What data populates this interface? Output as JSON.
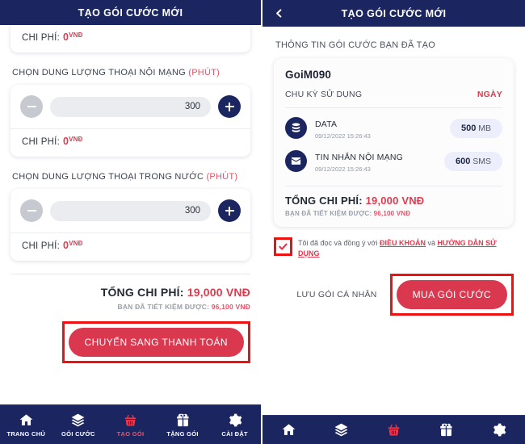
{
  "left": {
    "appbar": {
      "title": "TẠO GÓI CƯỚC MỚI"
    },
    "top_cost": {
      "label": "CHI PHÍ:",
      "amount": "0",
      "currency": "VNĐ"
    },
    "sections": [
      {
        "label": "CHỌN DUNG LƯỢNG THOẠI NỘI MẠNG",
        "unit": "(PHÚT)",
        "quantity": "300",
        "cost_label": "CHI PHÍ:",
        "cost_amount": "0",
        "cost_currency": "VNĐ"
      },
      {
        "label": "CHỌN DUNG LƯỢNG THOẠI TRONG NƯỚC",
        "unit": "(PHÚT)",
        "quantity": "300",
        "cost_label": "CHI PHÍ:",
        "cost_amount": "0",
        "cost_currency": "VNĐ"
      }
    ],
    "totals": {
      "total_label": "TỔNG CHI PHÍ:",
      "total_value": "19,000 VNĐ",
      "save_label": "BẠN ĐÃ TIẾT KIỆM ĐƯỢC:",
      "save_value": "96,100 VNĐ"
    },
    "cta": {
      "label": "CHUYỂN SANG THANH TOÁN"
    },
    "nav": [
      {
        "label": "TRANG CHỦ",
        "icon": "home-icon",
        "active": false
      },
      {
        "label": "GÓI CƯỚC",
        "icon": "layers-icon",
        "active": false
      },
      {
        "label": "TẠO GÓI",
        "icon": "basket-icon",
        "active": true
      },
      {
        "label": "TẶNG GÓI",
        "icon": "gift-icon",
        "active": false
      },
      {
        "label": "CÀI ĐẶT",
        "icon": "gear-icon",
        "active": false
      }
    ]
  },
  "right": {
    "appbar": {
      "title": "TẠO GÓI CƯỚC MỚI",
      "back_icon": "chevron-left-icon"
    },
    "section_title": "THÔNG TIN GÓI CƯỚC BẠN ĐÃ TẠO",
    "package": {
      "name": "GoiM090",
      "cycle_label": "CHU KỲ SỬ DỤNG",
      "cycle_value": "NGÀY",
      "features": [
        {
          "icon": "database-icon",
          "title": "DATA",
          "date": "09/12/2022 15:26:43",
          "badge_value": "500",
          "badge_unit": "MB"
        },
        {
          "icon": "envelope-icon",
          "title": "TIN NHẮN NỘI MẠNG",
          "date": "09/12/2022 15:26:43",
          "badge_value": "600",
          "badge_unit": "SMS"
        }
      ],
      "total_label": "TỔNG CHI PHÍ:",
      "total_value": "19,000 VNĐ",
      "save_label": "BẠN ĐÃ TIẾT KIỆM ĐƯỢC:",
      "save_value": "96,100 VNĐ"
    },
    "terms": {
      "prefix": "Tôi đã đọc và đồng ý với ",
      "link1": "ĐIỀU KHOẢN",
      "middle": " và ",
      "link2": "HƯỚNG DẪN SỬ DỤNG",
      "checked": true
    },
    "save_button": {
      "label": "LƯU GÓI CÁ NHÂN"
    },
    "buy_button": {
      "label": "MUA GÓI CƯỚC"
    },
    "nav": [
      {
        "icon": "home-icon",
        "active": false
      },
      {
        "icon": "layers-icon",
        "active": false
      },
      {
        "icon": "basket-icon",
        "active": true
      },
      {
        "icon": "gift-icon",
        "active": false
      },
      {
        "icon": "gear-icon",
        "active": false
      }
    ]
  },
  "colors": {
    "navy": "#1b2660",
    "red": "#e03a4e",
    "button_red": "#d9384f",
    "annotation_red": "#ee1111",
    "badge_bg": "#eceffb"
  }
}
